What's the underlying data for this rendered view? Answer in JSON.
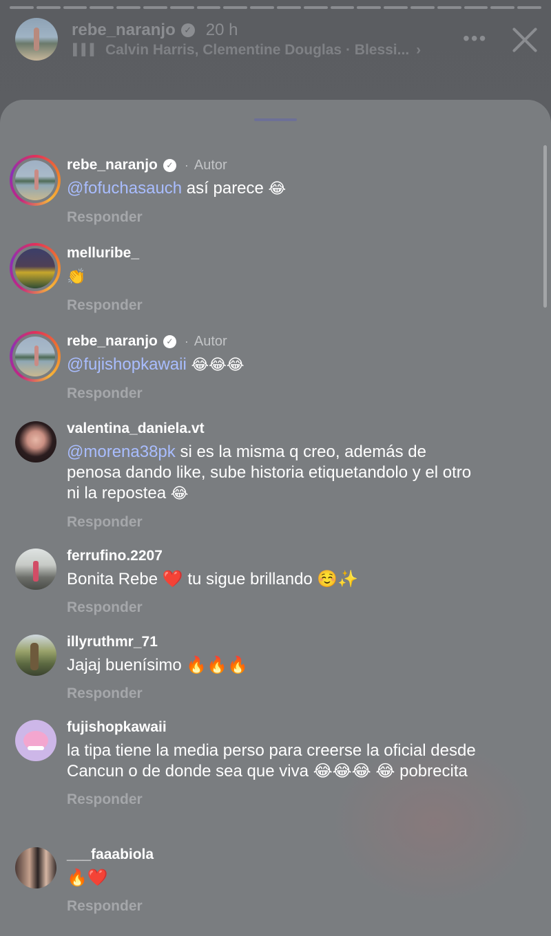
{
  "story": {
    "username": "rebe_naranjo",
    "time": "20 h",
    "music": "Calvin Harris, Clementine Douglas · Blessi...",
    "music_chevron": "›",
    "more_icon": "•••",
    "progress_segments": 20
  },
  "comments": [
    {
      "username": "rebe_naranjo",
      "verified": "✓",
      "author_label": "Autor",
      "dot": "·",
      "mention": "@fofuchasauch",
      "text": " así parece ",
      "emojis": "😂",
      "extra": "",
      "reply": "Responder"
    },
    {
      "username": "melluribe_",
      "text": "👏",
      "reply": "Responder"
    },
    {
      "username": "rebe_naranjo",
      "verified": "✓",
      "author_label": "Autor",
      "dot": "·",
      "mention": "@fujishopkawaii",
      "text": " ",
      "emojis": "😂😂😂",
      "extra": "",
      "reply": "Responder"
    },
    {
      "username": "valentina_daniela.vt",
      "mention": "@morena38pk",
      "text": " si es la misma q creo, además de penosa dando like, sube historia etiquetandolo y el otro ni la repostea ",
      "emojis": "😂",
      "extra": "",
      "reply": "Responder"
    },
    {
      "username": "ferrufino.2207",
      "text": "Bonita Rebe ❤️ tu sigue brillando ☺️✨",
      "reply": "Responder"
    },
    {
      "username": "illyruthmr_71",
      "text": "Jajaj buenísimo 🔥🔥🔥",
      "reply": "Responder"
    },
    {
      "username": "fujishopkawaii",
      "text": "la tipa tiene la media perso para creerse la oficial desde Cancun o de donde sea que viva 😂😂😂 😂 pobrecita",
      "reply": "Responder"
    },
    {
      "username": "___faaabiola",
      "text": "🔥❤️",
      "reply": "Responder"
    }
  ]
}
